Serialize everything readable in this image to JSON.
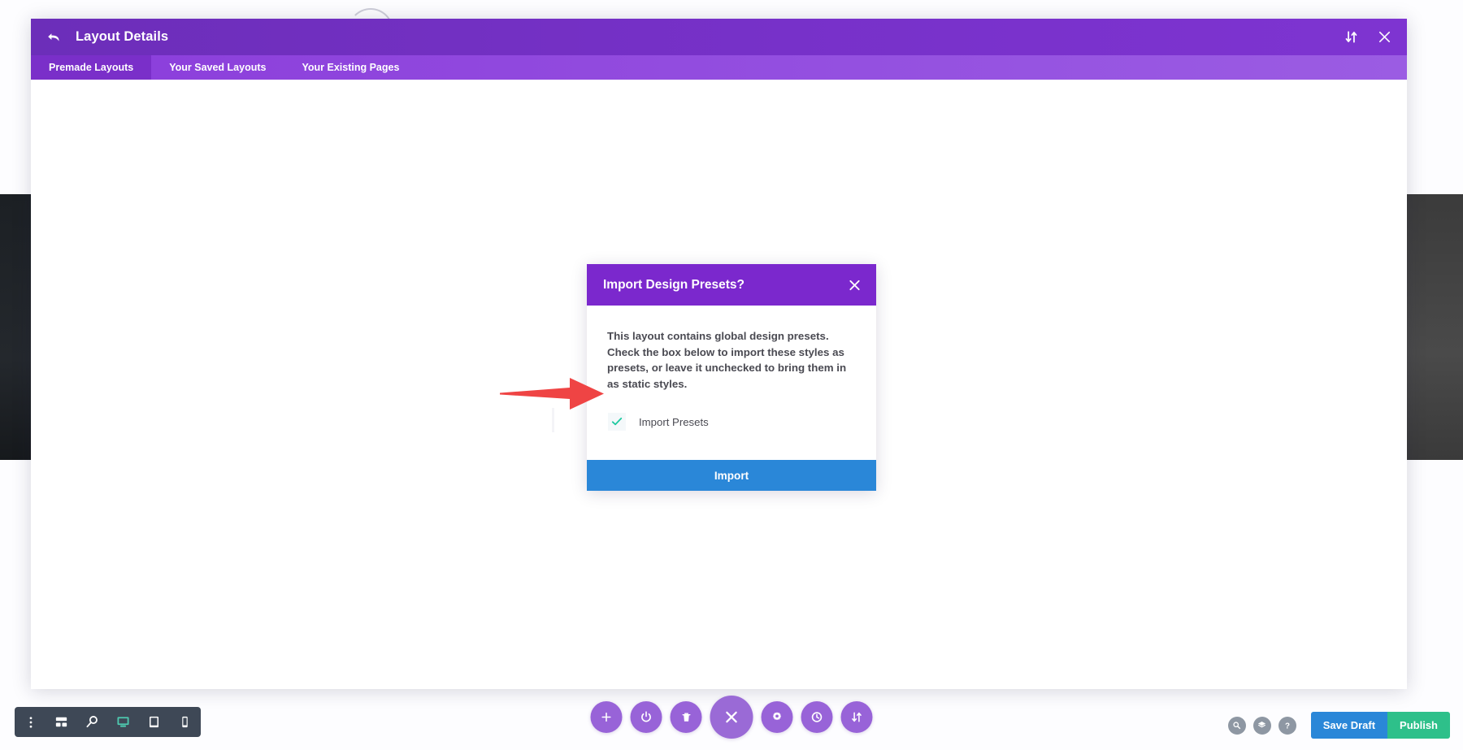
{
  "panel": {
    "title": "Layout Details",
    "back_icon": "back-arrow-icon",
    "header_actions": [
      {
        "name": "sort-toggle-icon",
        "label": "Sort"
      },
      {
        "name": "close-icon",
        "label": "Close"
      }
    ],
    "tabs": [
      {
        "label": "Premade Layouts",
        "active": true
      },
      {
        "label": "Your Saved Layouts",
        "active": false
      },
      {
        "label": "Your Existing Pages",
        "active": false
      }
    ]
  },
  "modal": {
    "title": "Import Design Presets?",
    "close_icon": "close-icon",
    "body_text": "This layout contains global design presets. Check the box below to import these styles as presets, or leave it unchecked to bring them in as static styles.",
    "checkbox": {
      "label": "Import Presets",
      "checked": true,
      "check_color": "#1dc9a0",
      "box_background": "#f4f8fa"
    },
    "import_button": {
      "label": "Import",
      "color": "#2a87d8"
    },
    "header_color": "#7b28cd"
  },
  "annotation": {
    "type": "arrow",
    "color": "#ef4444",
    "points_to": "import-presets-checkbox"
  },
  "bottom_bar": {
    "left_tools": [
      {
        "name": "more-options-icon",
        "label": "More Options",
        "active": false
      },
      {
        "name": "wireframe-icon",
        "label": "Wireframe View",
        "active": false
      },
      {
        "name": "zoom-out-icon",
        "label": "Zoom Out",
        "active": false
      },
      {
        "name": "desktop-icon",
        "label": "Desktop View",
        "active": true
      },
      {
        "name": "tablet-icon",
        "label": "Tablet View",
        "active": false
      },
      {
        "name": "phone-icon",
        "label": "Phone View",
        "active": false
      }
    ],
    "left_active_color": "#4ecab0",
    "center_tools": [
      {
        "name": "add-icon",
        "label": "Add Section",
        "big": false
      },
      {
        "name": "power-icon",
        "label": "Toggle Builder",
        "big": false
      },
      {
        "name": "trash-icon",
        "label": "Delete",
        "big": false
      },
      {
        "name": "close-icon",
        "label": "Close Settings",
        "big": true
      },
      {
        "name": "gear-icon",
        "label": "Settings",
        "big": false
      },
      {
        "name": "history-icon",
        "label": "Editing History",
        "big": false
      },
      {
        "name": "sort-toggle-icon",
        "label": "Portability",
        "big": false
      }
    ],
    "right_tools": [
      {
        "name": "zoom-out-icon",
        "label": "Zoom"
      },
      {
        "name": "layers-icon",
        "label": "Layers"
      },
      {
        "name": "help-icon",
        "label": "Help"
      }
    ],
    "save_draft_label": "Save Draft",
    "publish_label": "Publish",
    "save_draft_color": "#2a87d8",
    "publish_color": "#2ec08a"
  }
}
